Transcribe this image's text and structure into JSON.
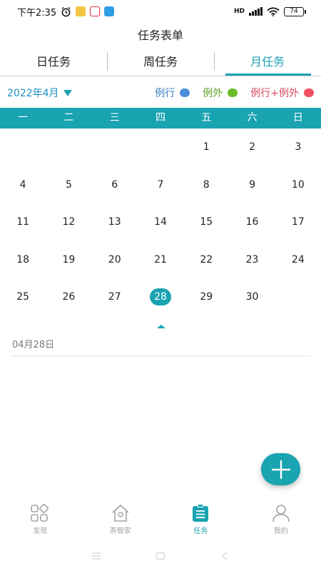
{
  "status_bar": {
    "time": "下午2:35",
    "network": "HD",
    "battery": "74"
  },
  "header": {
    "title": "任务表单"
  },
  "tabs": [
    {
      "label": "日任务",
      "active": false
    },
    {
      "label": "周任务",
      "active": false
    },
    {
      "label": "月任务",
      "active": true
    }
  ],
  "calendar_bar": {
    "month": "2022年4月",
    "legend": [
      {
        "label": "例行",
        "color": "#4a8fd9"
      },
      {
        "label": "例外",
        "color": "#6dbb2a"
      },
      {
        "label": "例行+例外",
        "color": "#ef4f63"
      }
    ],
    "legend_text_colors": [
      "#3a7fc8",
      "#5aa020",
      "#d8485f"
    ]
  },
  "weekdays": [
    "一",
    "二",
    "三",
    "四",
    "五",
    "六",
    "日"
  ],
  "weeks": [
    [
      "",
      "",
      "",
      "",
      "1",
      "2",
      "3"
    ],
    [
      "4",
      "5",
      "6",
      "7",
      "8",
      "9",
      "10"
    ],
    [
      "11",
      "12",
      "13",
      "14",
      "15",
      "16",
      "17"
    ],
    [
      "18",
      "19",
      "20",
      "21",
      "22",
      "23",
      "24"
    ],
    [
      "25",
      "26",
      "27",
      "28",
      "29",
      "30",
      ""
    ]
  ],
  "selected_day": "28",
  "selected_date_label": "04月28日",
  "bottom_nav": [
    {
      "label": "发现",
      "icon": "discover-icon",
      "active": false
    },
    {
      "label": "燕智家",
      "icon": "home-icon",
      "active": false
    },
    {
      "label": "任务",
      "icon": "task-icon",
      "active": true
    },
    {
      "label": "我的",
      "icon": "profile-icon",
      "active": false
    }
  ],
  "colors": {
    "accent": "#1aa3b0",
    "inactive": "#a3a3a3"
  }
}
